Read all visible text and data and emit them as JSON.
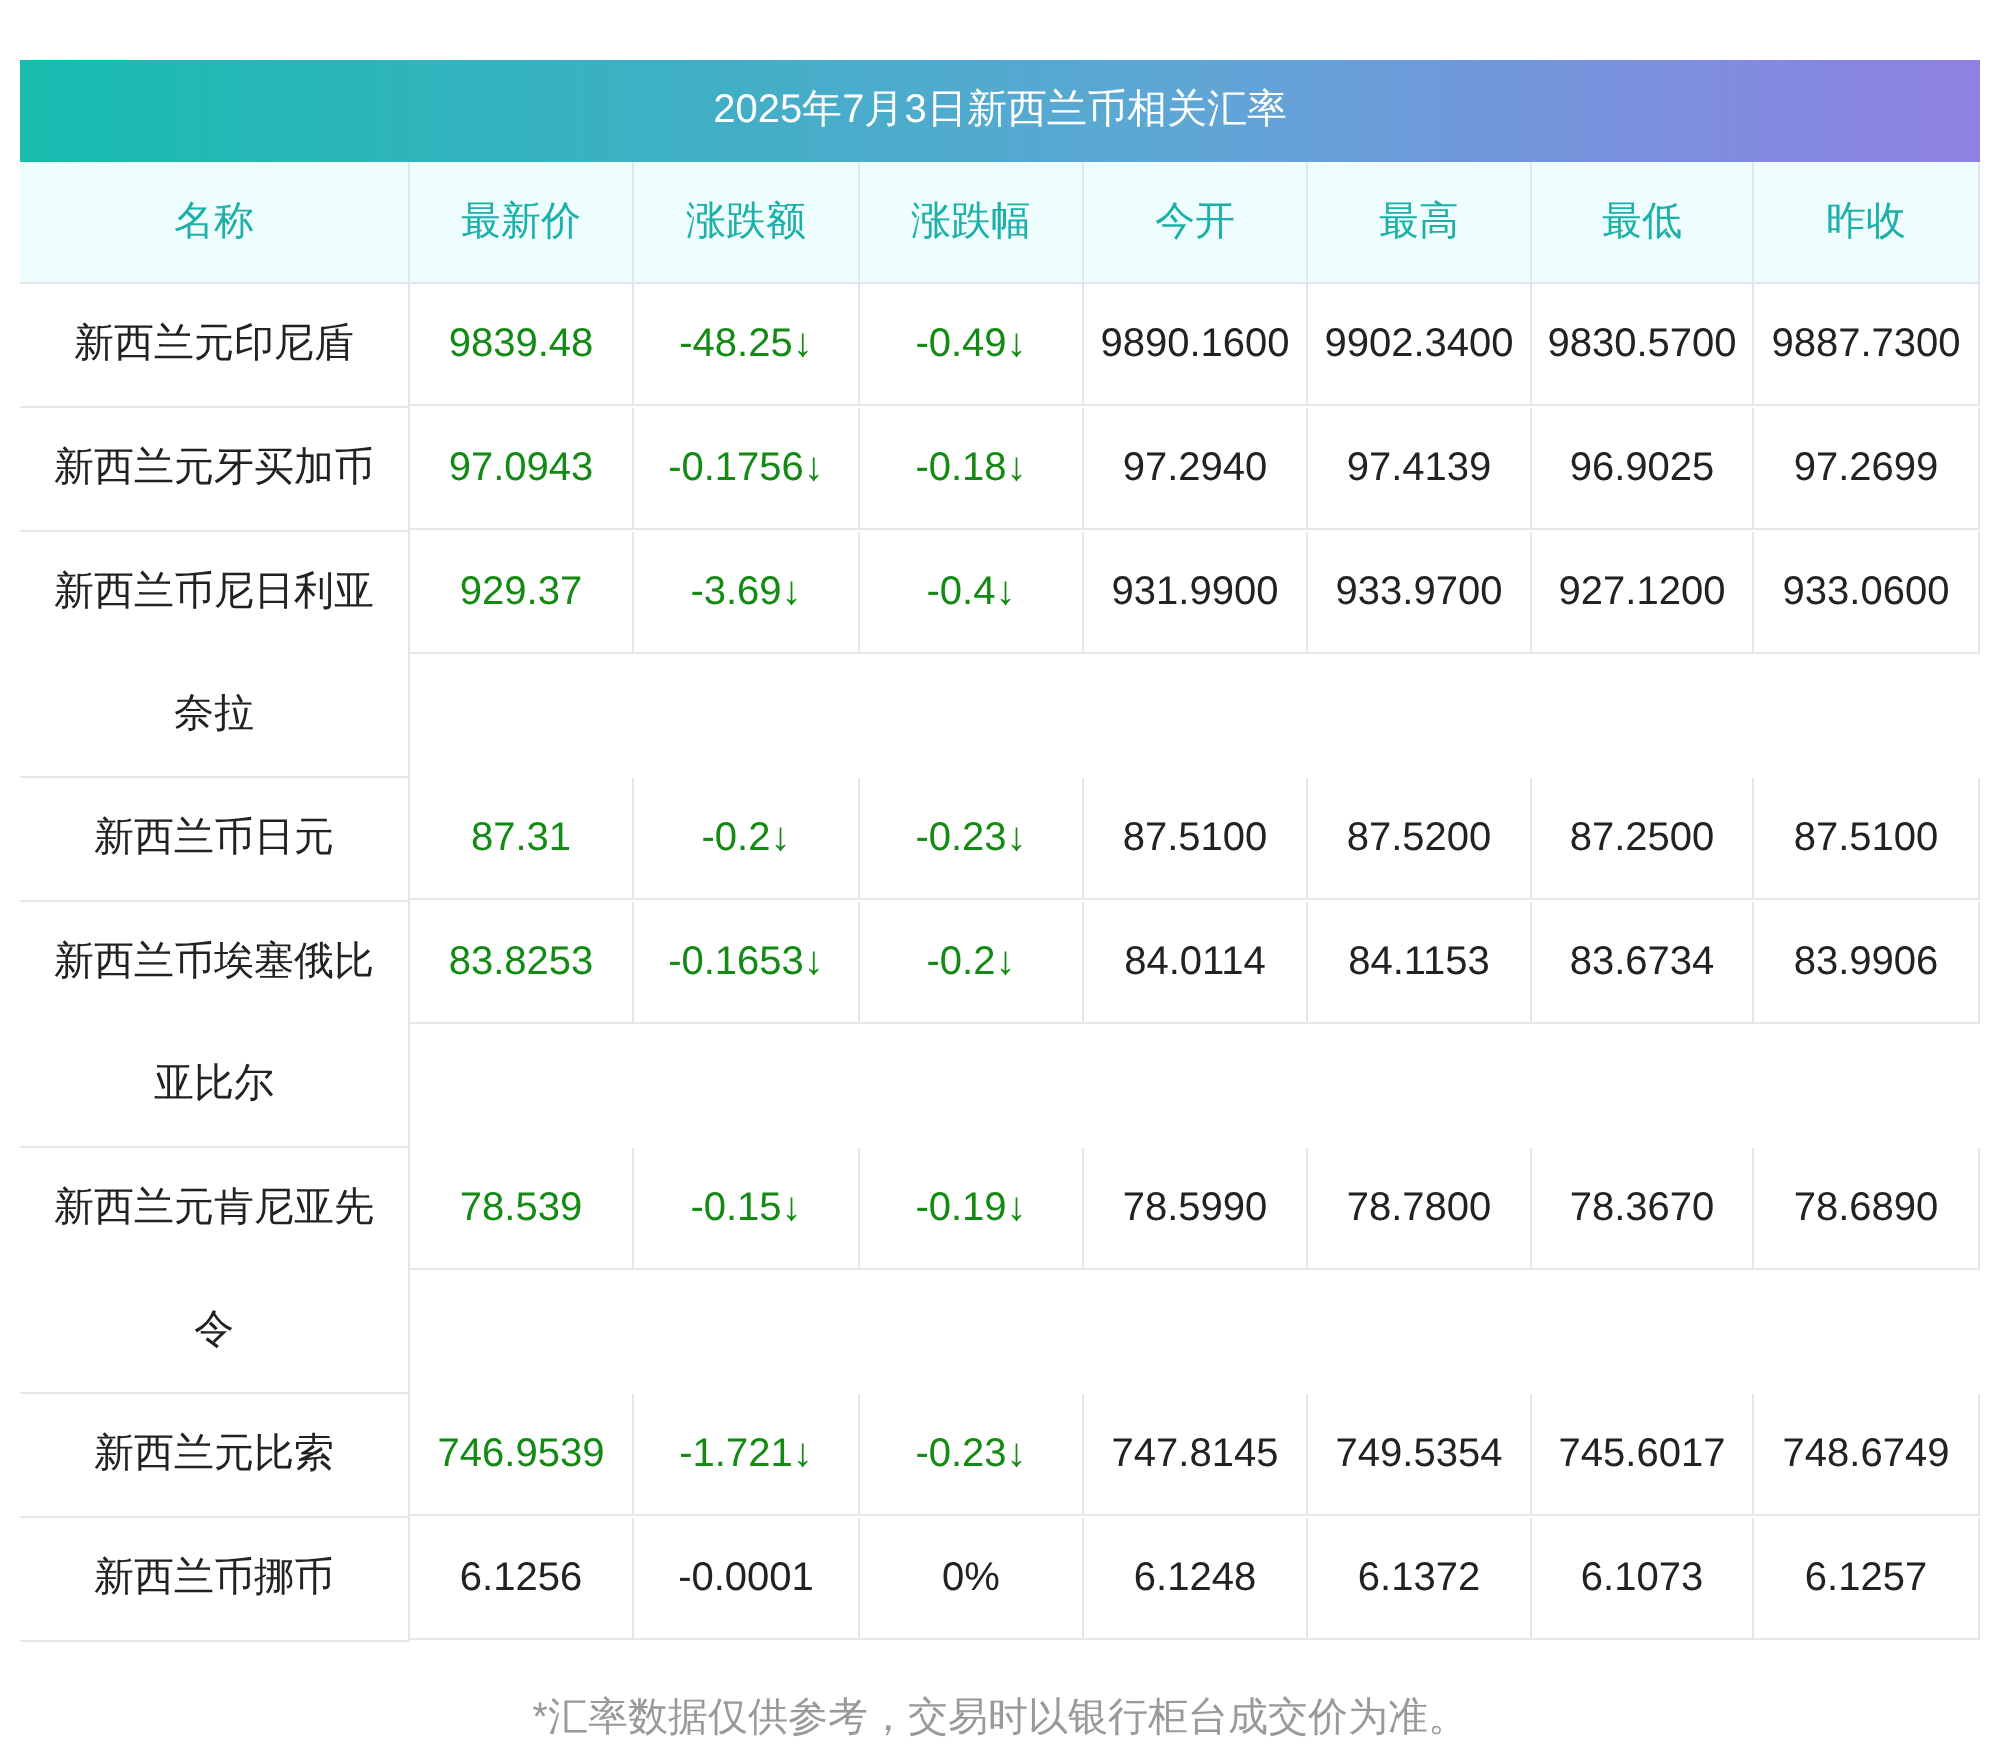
{
  "title": "2025年7月3日新西兰币相关汇率",
  "columns": [
    "名称",
    "最新价",
    "涨跌额",
    "涨跌幅",
    "今开",
    "最高",
    "最低",
    "昨收"
  ],
  "rows": [
    {
      "name": "新西兰元印尼盾",
      "kind": "down",
      "cells": [
        "9839.48",
        "-48.25↓",
        "-0.49↓",
        "9890.1600",
        "9902.3400",
        "9830.5700",
        "9887.7300"
      ]
    },
    {
      "name": "新西兰元牙买加币",
      "kind": "down",
      "cells": [
        "97.0943",
        "-0.1756↓",
        "-0.18↓",
        "97.2940",
        "97.4139",
        "96.9025",
        "97.2699"
      ]
    },
    {
      "name": "新西兰币尼日利亚奈拉",
      "kind": "down",
      "cells": [
        "929.37",
        "-3.69↓",
        "-0.4↓",
        "931.9900",
        "933.9700",
        "927.1200",
        "933.0600"
      ]
    },
    {
      "name": "新西兰币日元",
      "kind": "down",
      "cells": [
        "87.31",
        "-0.2↓",
        "-0.23↓",
        "87.5100",
        "87.5200",
        "87.2500",
        "87.5100"
      ]
    },
    {
      "name": "新西兰币埃塞俄比亚比尔",
      "kind": "down",
      "cells": [
        "83.8253",
        "-0.1653↓",
        "-0.2↓",
        "84.0114",
        "84.1153",
        "83.6734",
        "83.9906"
      ]
    },
    {
      "name": "新西兰元肯尼亚先令",
      "kind": "down",
      "cells": [
        "78.539",
        "-0.15↓",
        "-0.19↓",
        "78.5990",
        "78.7800",
        "78.3670",
        "78.6890"
      ]
    },
    {
      "name": "新西兰元比索",
      "kind": "down",
      "cells": [
        "746.9539",
        "-1.721↓",
        "-0.23↓",
        "747.8145",
        "749.5354",
        "745.6017",
        "748.6749"
      ]
    },
    {
      "name": "新西兰币挪币",
      "kind": "flat",
      "cells": [
        "6.1256",
        "-0.0001",
        "0%",
        "6.1248",
        "6.1372",
        "6.1073",
        "6.1257"
      ]
    }
  ],
  "footnote": "*汇率数据仅供参考，交易时以银行柜台成交价为准。"
}
